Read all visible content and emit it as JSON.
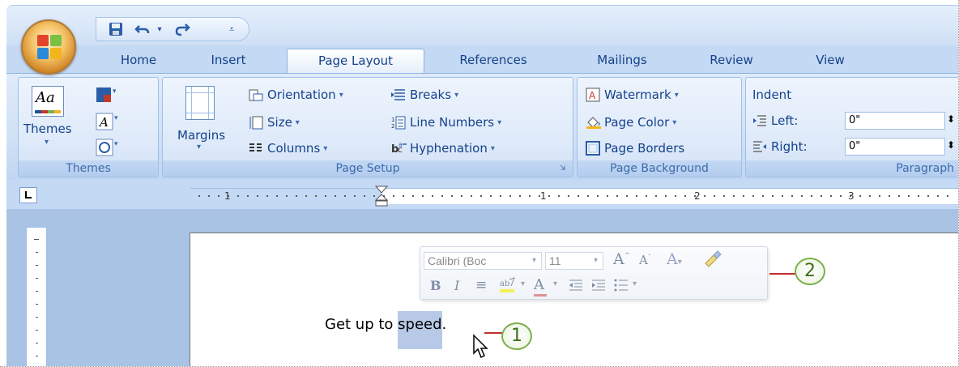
{
  "colors": {
    "ribbon_text": "#15428b",
    "callout_green": "#7ab04a",
    "callout_line": "#c0302a",
    "selection": "#b7c9e6"
  },
  "qat": {
    "save_icon": "save-icon",
    "undo_icon": "undo-icon",
    "redo_icon": "redo-icon",
    "customize_icon": "customize-qat-icon"
  },
  "tabs": [
    "Home",
    "Insert",
    "Page Layout",
    "References",
    "Mailings",
    "Review",
    "View"
  ],
  "active_tab": "Page Layout",
  "ribbon": {
    "themes": {
      "themes_label": "Themes",
      "group_label": "Themes"
    },
    "page_setup": {
      "margins": "Margins",
      "orientation": "Orientation",
      "size": "Size",
      "columns": "Columns",
      "breaks": "Breaks",
      "line_numbers": "Line Numbers",
      "hyphenation": "Hyphenation",
      "group_label": "Page Setup"
    },
    "page_background": {
      "watermark": "Watermark",
      "page_color": "Page Color",
      "page_borders": "Page Borders",
      "group_label": "Page Background"
    },
    "paragraph": {
      "indent": "Indent",
      "left_label": "Left:",
      "left_value": "0\"",
      "right_label": "Right:",
      "right_value": "0\"",
      "group_label": "Paragraph"
    }
  },
  "ruler": {
    "labels": [
      "1",
      "1",
      "2",
      "3"
    ]
  },
  "mini_toolbar": {
    "font": "Calibri (Boc",
    "size": "11"
  },
  "document": {
    "text_before": "Get up to ",
    "selected_text": "speed",
    "text_after": "."
  },
  "callouts": {
    "one": "1",
    "two": "2"
  }
}
